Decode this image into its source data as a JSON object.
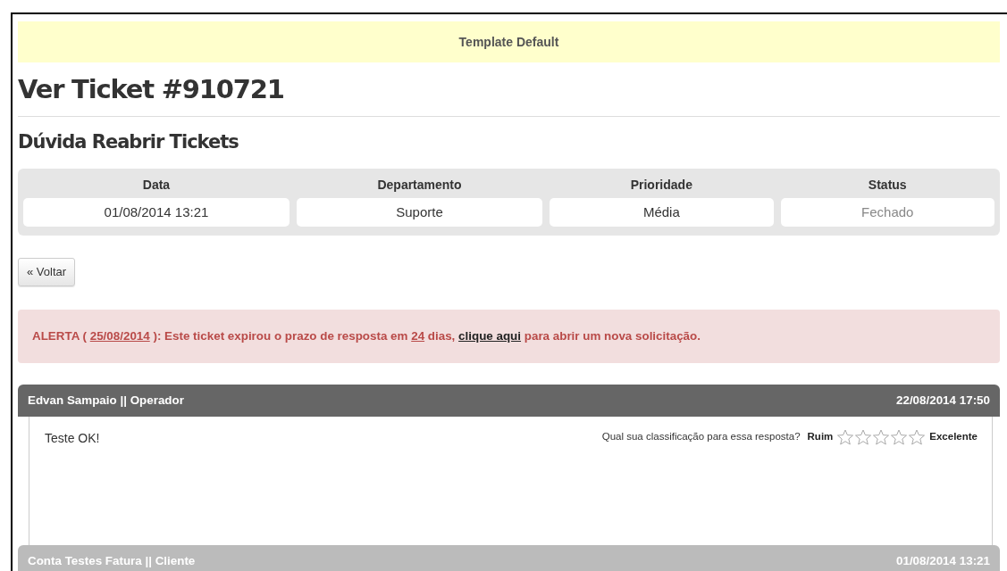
{
  "template_bar": {
    "text": "Template Default"
  },
  "page_title": "Ver Ticket #910721",
  "subject": "Dúvida Reabrir Tickets",
  "info": [
    {
      "label": "Data",
      "value": "01/08/2014 13:21",
      "muted": false
    },
    {
      "label": "Departamento",
      "value": "Suporte",
      "muted": false
    },
    {
      "label": "Prioridade",
      "value": "Média",
      "muted": false
    },
    {
      "label": "Status",
      "value": "Fechado",
      "muted": true
    }
  ],
  "back_button": "« Voltar",
  "alert": {
    "prefix": "ALERTA (",
    "date_link": "25/08/2014",
    "middle": "): Este ticket expirou o prazo de resposta em",
    "days_link": "24",
    "after_days": "dias,",
    "action_link": "clique aqui",
    "suffix": "para abrir um nova solicitação."
  },
  "messages": [
    {
      "kind": "operator",
      "author": "Edvan Sampaio || Operador",
      "date": "22/08/2014 17:50",
      "body": "Teste OK!",
      "rating": {
        "question": "Qual sua classificação para essa resposta?",
        "low": "Ruim",
        "high": "Excelente",
        "stars": 0
      }
    },
    {
      "kind": "client",
      "author": "Conta Testes Fatura || Cliente",
      "date": "01/08/2014 13:21"
    }
  ]
}
